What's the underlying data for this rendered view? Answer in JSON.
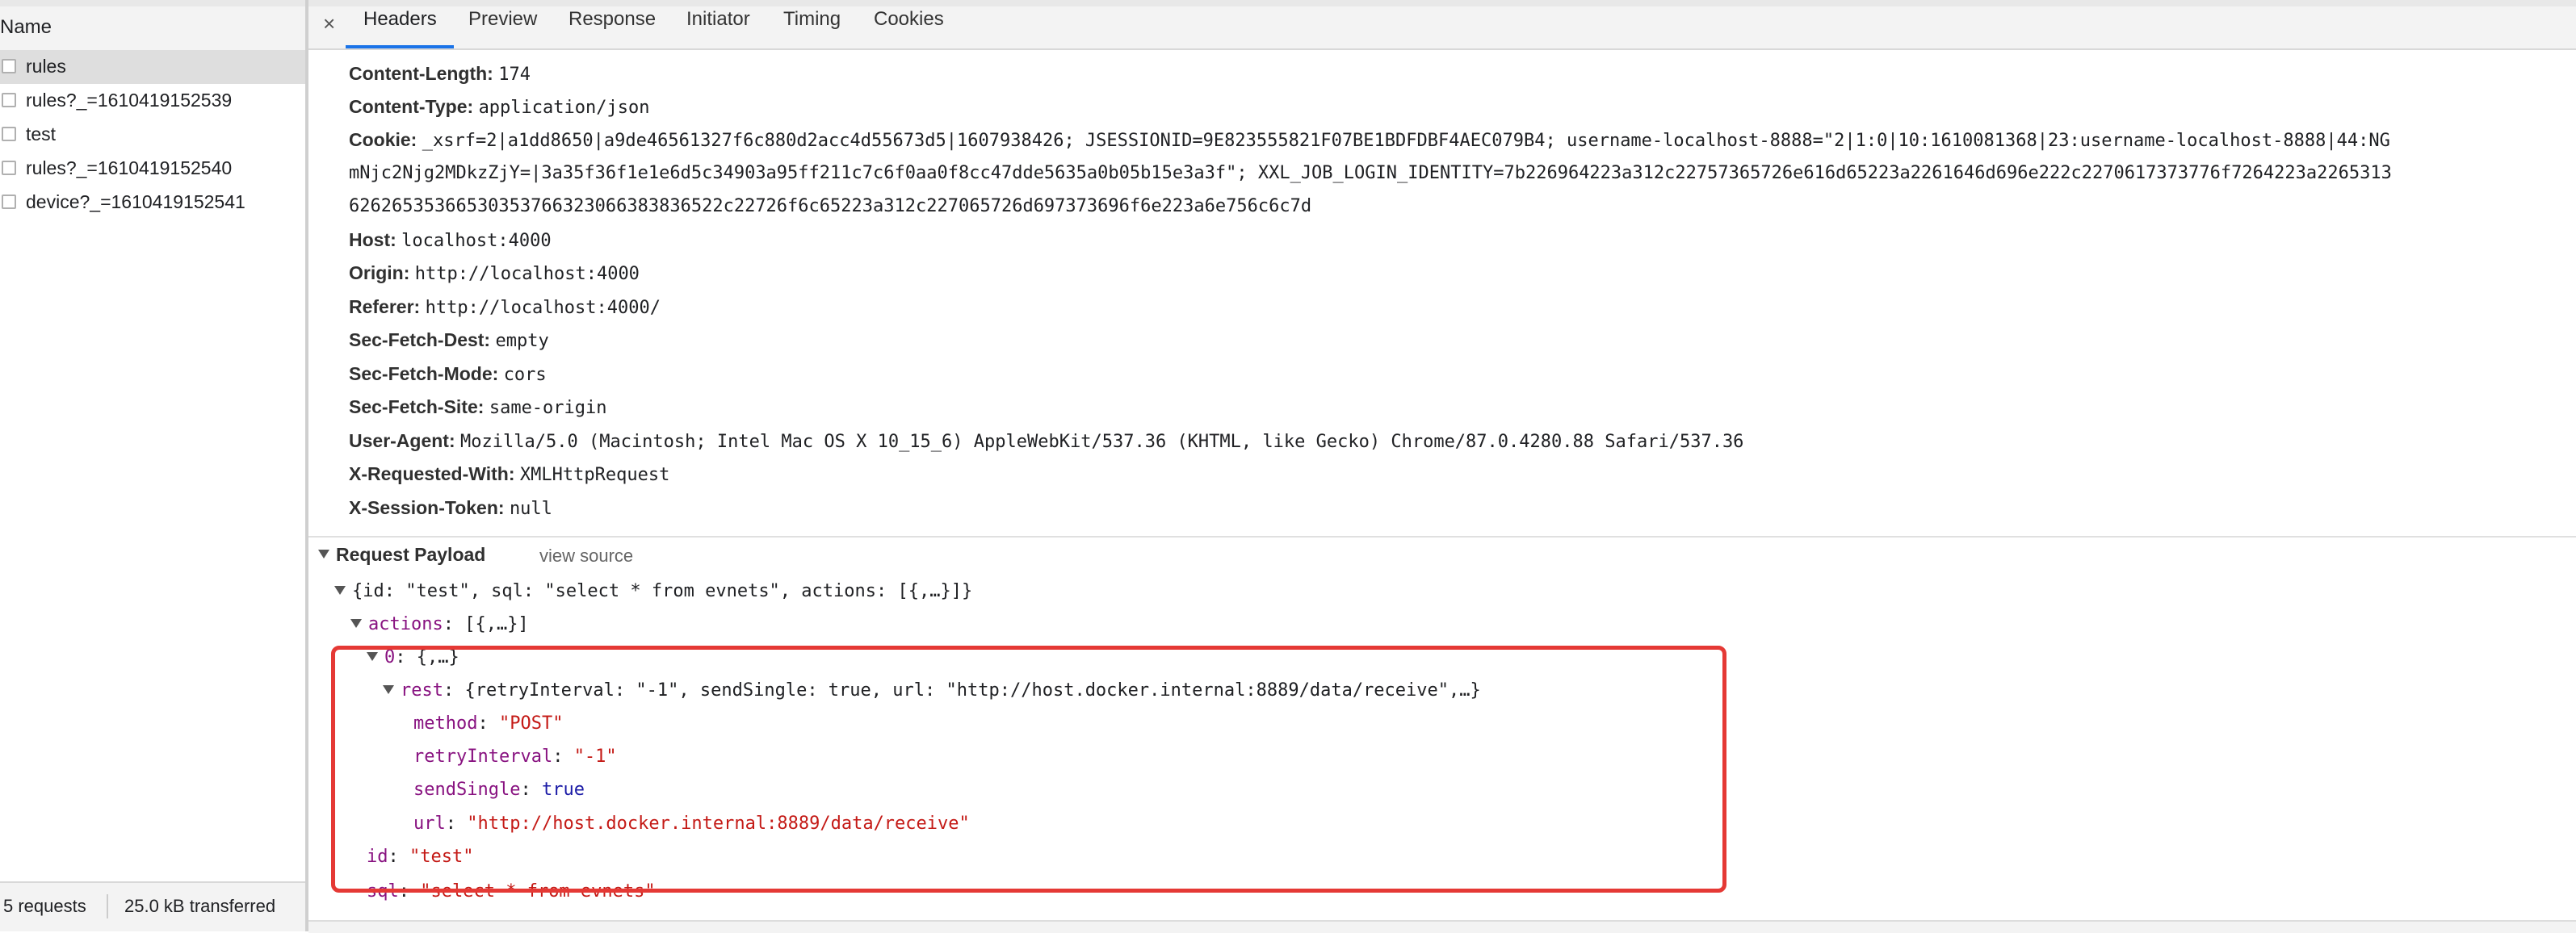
{
  "network_list": {
    "header": "Name",
    "requests": [
      {
        "name": "rules"
      },
      {
        "name": "rules?_=1610419152539"
      },
      {
        "name": "test"
      },
      {
        "name": "rules?_=1610419152540"
      },
      {
        "name": "device?_=1610419152541"
      }
    ],
    "footer": {
      "requests_count": "5 requests",
      "transferred": "25.0 kB transferred"
    }
  },
  "tabs": {
    "close_symbol": "×",
    "items": [
      "Headers",
      "Preview",
      "Response",
      "Initiator",
      "Timing",
      "Cookies"
    ],
    "active": "Headers"
  },
  "headers": {
    "content_length": {
      "key": "Content-Length:",
      "value": "174"
    },
    "content_type": {
      "key": "Content-Type:",
      "value": "application/json"
    },
    "cookie": {
      "key": "Cookie:",
      "line1": "_xsrf=2|a1dd8650|a9de46561327f6c880d2acc4d55673d5|1607938426; JSESSIONID=9E823555821F07BE1BDFDBF4AEC079B4; username-localhost-8888=\"2|1:0|10:1610081368|23:username-localhost-8888|44:NG",
      "line2": "mNjc2Njg2MDkzZjY=|3a35f36f1e1e6d5c34903a95ff211c7c6f0aa0f8cc47dde5635a0b05b15e3a3f\"; XXL_JOB_LOGIN_IDENTITY=7b226964223a312c22757365726e616d65223a2261646d696e222c2270617373776f7264223a2265313",
      "line3": "62626535366530353766323066383836522c22726f6c65223a312c227065726d697373696f6e223a6e756c6c7d"
    },
    "host": {
      "key": "Host:",
      "value": "localhost:4000"
    },
    "origin": {
      "key": "Origin:",
      "value": "http://localhost:4000"
    },
    "referer": {
      "key": "Referer:",
      "value": "http://localhost:4000/"
    },
    "sec_fetch_dest": {
      "key": "Sec-Fetch-Dest:",
      "value": "empty"
    },
    "sec_fetch_mode": {
      "key": "Sec-Fetch-Mode:",
      "value": "cors"
    },
    "sec_fetch_site": {
      "key": "Sec-Fetch-Site:",
      "value": "same-origin"
    },
    "user_agent": {
      "key": "User-Agent:",
      "value": "Mozilla/5.0 (Macintosh; Intel Mac OS X 10_15_6) AppleWebKit/537.36 (KHTML, like Gecko) Chrome/87.0.4280.88 Safari/537.36"
    },
    "x_requested_with": {
      "key": "X-Requested-With:",
      "value": "XMLHttpRequest"
    },
    "x_session_token": {
      "key": "X-Session-Token:",
      "value": "null"
    }
  },
  "payload": {
    "title": "Request Payload",
    "view_source": "view source",
    "root_summary": "{id: \"test\", sql: \"select * from evnets\", actions: [{,…}]}",
    "actions_key": "actions",
    "actions_summary": ": [{,…}]",
    "item0_key": "0",
    "item0_summary": ": {,…}",
    "rest_key": "rest",
    "rest_summary": ": {retryInterval: \"-1\", sendSingle: true, url: \"http://host.docker.internal:8889/data/receive\",…}",
    "method_key": "method",
    "method_value": "\"POST\"",
    "retry_key": "retryInterval",
    "retry_value": "\"-1\"",
    "send_key": "sendSingle",
    "send_value": "true",
    "url_key": "url",
    "url_value": "\"http://host.docker.internal:8889/data/receive\"",
    "id_key": "id",
    "id_value": "\"test\"",
    "sql_key": "sql",
    "sql_value": "\"select * from evnets\"",
    "colon": ": "
  },
  "colors": {
    "highlight_border": "#e53935",
    "tab_underline": "#1a73e8"
  }
}
